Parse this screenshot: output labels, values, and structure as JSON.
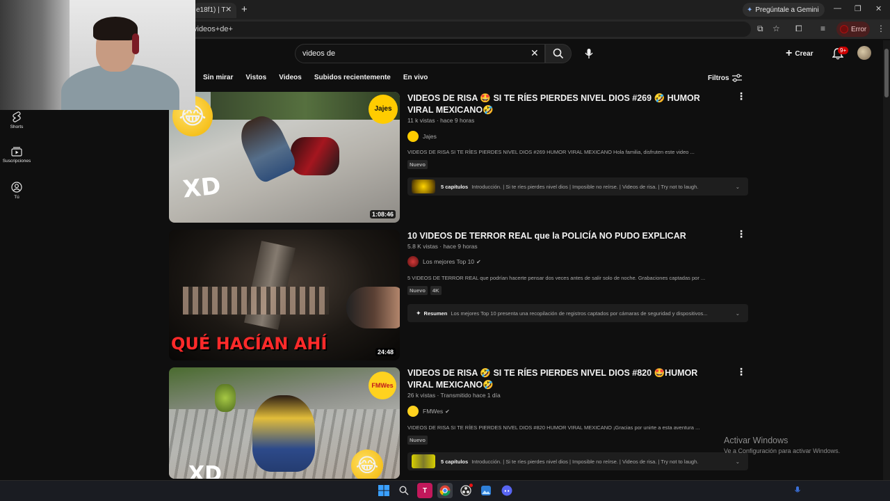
{
  "browser": {
    "tab_title": "e18f1) | T",
    "gemini_label": "Pregúntale a Gemini",
    "url_text": "videos+de+",
    "error_label": "Error"
  },
  "search": {
    "query": "videos de"
  },
  "header": {
    "create_label": "Crear",
    "notifications_badge": "9+"
  },
  "chips": [
    "Sin mirar",
    "Vistos",
    "Videos",
    "Subidos recientemente",
    "En vivo"
  ],
  "filters_label": "Filtros",
  "rail": {
    "shorts": "Shorts",
    "subscriptions": "Suscripciones",
    "you": "Tú"
  },
  "results": [
    {
      "title": "VIDEOS DE RISA 🤩 SI TE RÍES PIERDES NIVEL DIOS #269 🤣 HUMOR VIRAL MEXICANO🤣",
      "meta": "11 k vistas · hace 9 horas",
      "channel": "Jajes",
      "description": "VIDEOS DE RISA SI TE RÍES PIERDES NIVEL DIOS #269 HUMOR VIRAL MEXICANO Hola familia, disfruten este video ...",
      "badges": [
        "Nuevo"
      ],
      "duration": "1:08:46",
      "thumb_text": "XD",
      "chapters_label": "5 capítulos",
      "chapters_text": "Introducción. | Si te ríes pierdes nivel dios | Imposible no reírse. | Videos de risa. | Try not to laugh."
    },
    {
      "title": "10 VIDEOS DE TERROR REAL que la POLICÍA NO PUDO EXPLICAR",
      "meta": "5.8 K vistas · hace 9 horas",
      "channel": "Los mejores Top 10",
      "description": "5 VIDEOS DE TERROR REAL que podrían hacerte pensar dos veces antes de salir solo de noche. Grabaciones captadas por ...",
      "badges": [
        "Nuevo",
        "4K"
      ],
      "duration": "24:48",
      "thumb_text": "QUÉ HACÍAN AHÍ",
      "chapters_label": "Resumen",
      "chapters_text": "Los mejores Top 10 presenta una recopilación de registros captados por cámaras de seguridad y dispositivos..."
    },
    {
      "title": "VIDEOS DE RISA 🤣 SI TE RÍES PIERDES NIVEL DIOS #820 🤩HUMOR VIRAL MEXICANO🤣",
      "meta": "26 k vistas · Transmitido hace 1 día",
      "channel": "FMWes",
      "description": "VIDEOS DE RISA SI TE RÍES PIERDES NIVEL DIOS #820 HUMOR VIRAL MEXICANO ¡Gracias por unirte a esta aventura ...",
      "badges": [
        "Nuevo"
      ],
      "duration": "",
      "thumb_text": "XD",
      "chapters_label": "5 capítulos",
      "chapters_text": "Introducción. | Si te ríes pierdes nivel dios | Imposible no reírse. | Videos de risa. | Try not to laugh."
    }
  ],
  "watermark": {
    "line1": "Activar Windows",
    "line2": "Ve a Configuración para activar Windows."
  },
  "colors": {
    "background": "#0f0f0f",
    "accent_red": "#cc0000"
  }
}
